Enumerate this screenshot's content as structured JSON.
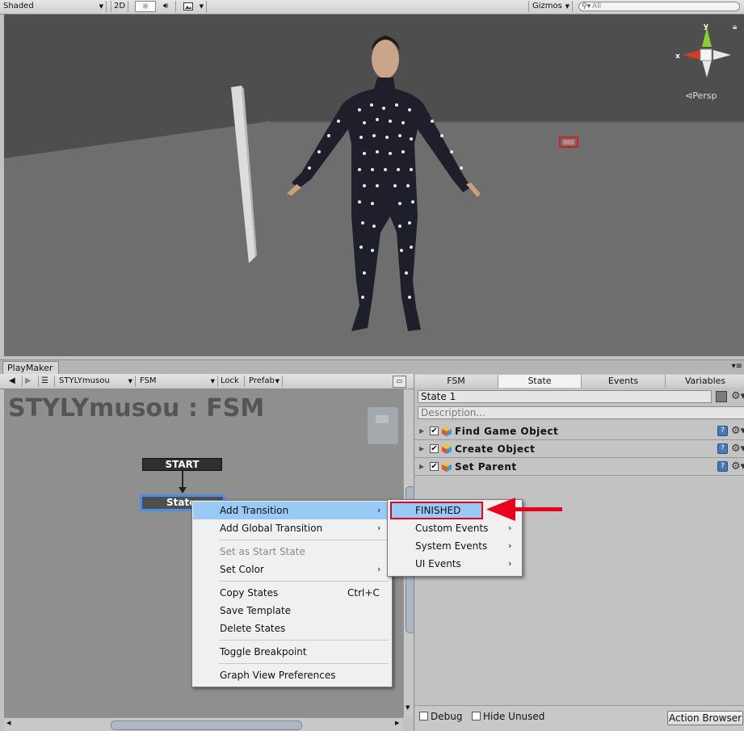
{
  "scene_toolbar": {
    "shading_mode": "Shaded",
    "mode_2d": "2D",
    "lighting_icon": "sun-icon",
    "audio_icon": "speaker-icon",
    "effects_icon": "image-icon",
    "gizmos_label": "Gizmos",
    "search_placeholder": "All"
  },
  "scene_gizmo": {
    "axis_x": "x",
    "axis_y": "y",
    "projection": "Persp"
  },
  "playmaker": {
    "window_tab": "PlayMaker",
    "toolbar": {
      "game_object": "STYLYmusou",
      "fsm": "FSM",
      "lock": "Lock",
      "prefab": "Prefab"
    },
    "graph_title": "STYLYmusou : FSM",
    "start_node": "START",
    "state_node": "State"
  },
  "context_menu": {
    "items": [
      {
        "label": "Add Transition",
        "submenu": true,
        "highlighted": true
      },
      {
        "label": "Add Global Transition",
        "submenu": true
      },
      {
        "label": "Set as Start State",
        "disabled": true
      },
      {
        "label": "Set Color",
        "submenu": true
      },
      {
        "label": "Copy States",
        "shortcut": "Ctrl+C"
      },
      {
        "label": "Save Template"
      },
      {
        "label": "Delete States"
      },
      {
        "label": "Toggle Breakpoint"
      },
      {
        "label": "Graph View Preferences"
      }
    ]
  },
  "transition_submenu": {
    "items": [
      {
        "label": "FINISHED",
        "highlighted": true
      },
      {
        "label": "Custom Events",
        "submenu": true
      },
      {
        "label": "System Events",
        "submenu": true
      },
      {
        "label": "UI Events",
        "submenu": true
      }
    ]
  },
  "inspector": {
    "tabs": [
      "FSM",
      "State",
      "Events",
      "Variables"
    ],
    "active_tab": "State",
    "state_name": "State 1",
    "description_placeholder": "Description...",
    "actions": [
      {
        "name": "Find Game Object",
        "enabled": true
      },
      {
        "name": "Create Object",
        "enabled": true
      },
      {
        "name": "Set Parent",
        "enabled": true
      }
    ],
    "debug_label": "Debug",
    "hide_unused_label": "Hide Unused",
    "action_browser_label": "Action Browser"
  },
  "colors": {
    "selection_highlight": "#99c9f5",
    "annotation_red": "#e8001c",
    "state_border": "#4f8ee8"
  }
}
